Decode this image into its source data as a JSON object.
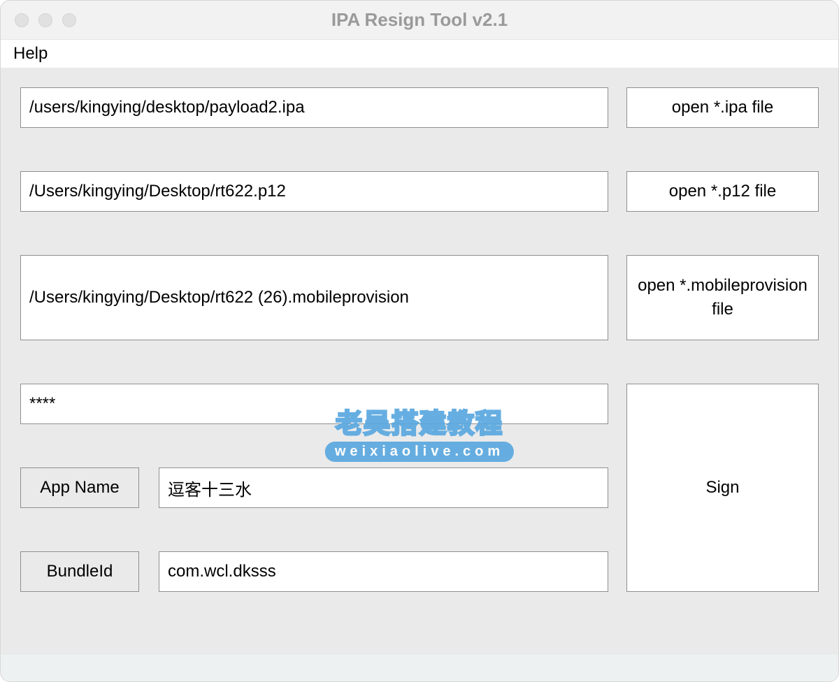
{
  "window": {
    "title": "IPA Resign Tool v2.1"
  },
  "menu": {
    "help": "Help"
  },
  "fields": {
    "ipa_path": "/users/kingying/desktop/payload2.ipa",
    "p12_path": "/Users/kingying/Desktop/rt622.p12",
    "mobileprovision_path": "/Users/kingying/Desktop/rt622 (26).mobileprovision",
    "password": "****",
    "app_name": "逗客十三水",
    "bundle_id": "com.wcl.dksss"
  },
  "labels": {
    "app_name": "App Name",
    "bundle_id": "BundleId"
  },
  "buttons": {
    "open_ipa": "open *.ipa file",
    "open_p12": "open *.p12 file",
    "open_mobileprovision": "open *.mobileprovision  file",
    "sign": "Sign"
  },
  "watermark": {
    "line1": "老吴搭建教程",
    "line2": "weixiaolive.com"
  }
}
